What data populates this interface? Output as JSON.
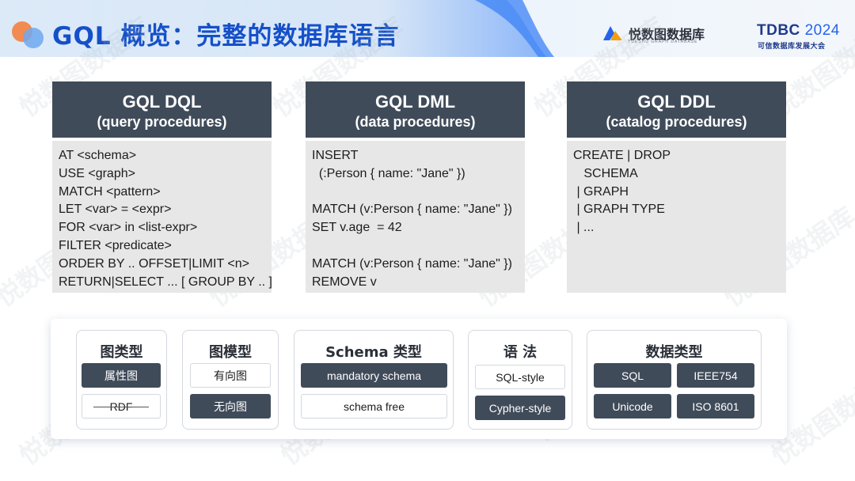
{
  "header": {
    "title": "GQL 概览：完整的数据库语言",
    "brand_name": "悦数图数据库",
    "brand_sub": "YUESHU GRAPH DATABASE",
    "event": "TDBC",
    "event_year": "2024",
    "event_sub": "可信数据库发展大会"
  },
  "watermark": "悦数图数据库",
  "cards": [
    {
      "title": "GQL DQL",
      "subtitle": "(query procedures)",
      "lines": [
        "AT <schema>",
        "USE <graph>",
        "MATCH <pattern>",
        "LET <var> = <expr>",
        "FOR <var> in <list-expr>",
        "FILTER <predicate>",
        "ORDER BY .. OFFSET|LIMIT <n>",
        "RETURN|SELECT ... [ GROUP BY .. ]"
      ]
    },
    {
      "title": "GQL DML",
      "subtitle": "(data procedures)",
      "lines": [
        "INSERT",
        "  (:Person { name: \"Jane\" })",
        "",
        "MATCH (v:Person { name: \"Jane\" })",
        "SET v.age  = 42",
        "",
        "MATCH (v:Person { name: \"Jane\" })",
        "REMOVE v"
      ]
    },
    {
      "title": "GQL DDL",
      "subtitle": "(catalog  procedures)",
      "lines": [
        "CREATE | DROP",
        "   SCHEMA",
        " | GRAPH",
        " | GRAPH TYPE",
        " | ..."
      ]
    }
  ],
  "groups": [
    {
      "title": "图类型",
      "items": [
        "属性图",
        "RDF"
      ]
    },
    {
      "title": "图模型",
      "items": [
        "有向图",
        "无向图"
      ]
    },
    {
      "title": "Schema 类型",
      "items": [
        "mandatory schema",
        "schema free"
      ]
    },
    {
      "title": "语 法",
      "items": [
        "SQL-style",
        "Cypher-style"
      ]
    },
    {
      "title": "数据类型",
      "items": [
        "SQL",
        "IEEE754",
        "Unicode",
        "ISO 8601"
      ]
    }
  ],
  "colors": {
    "title_blue": "#1550c9",
    "card_header": "#404b5a",
    "card_body": "#e7e7e7"
  }
}
